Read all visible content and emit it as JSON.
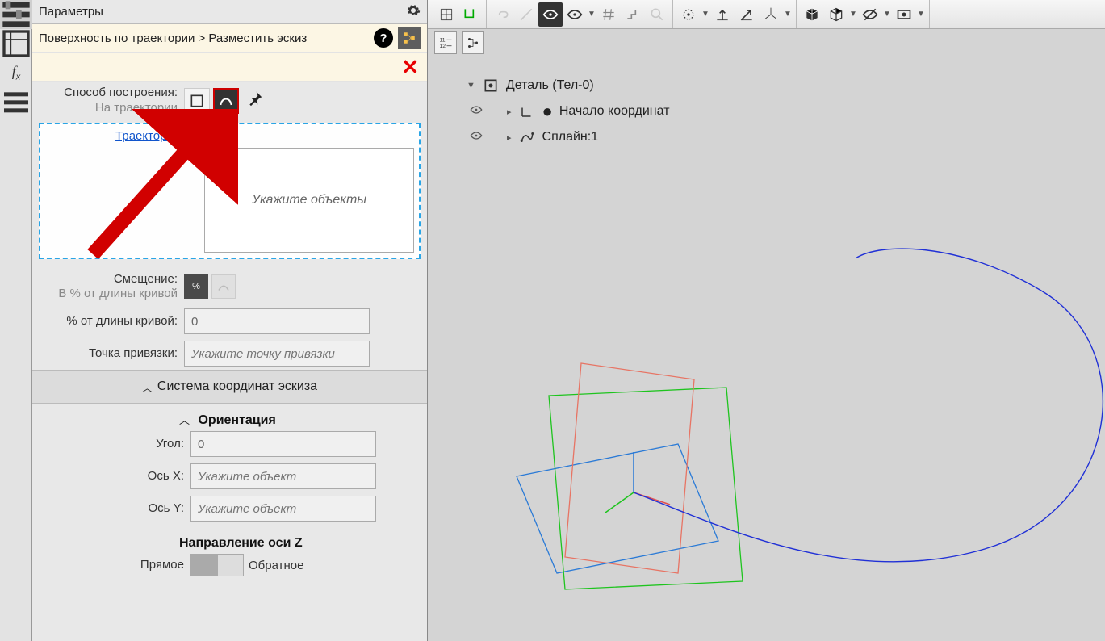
{
  "panel": {
    "title": "Параметры",
    "breadcrumb": "Поверхность по траектории > Разместить эскиз"
  },
  "build": {
    "method_label": "Способ построения:",
    "method_sub": "На траектории",
    "trajectory_link": "Траектория",
    "placeholder_objects": "Укажите объекты"
  },
  "offset": {
    "label1": "Смещение:",
    "label2": "В % от длины кривой",
    "pct_label": "% от длины кривой:",
    "pct_value": "0",
    "anchor_label": "Точка привязки:",
    "anchor_placeholder": "Укажите точку привязки"
  },
  "sections": {
    "coords": "Система координат эскиза",
    "orient": "Ориентация",
    "angle_label": "Угол:",
    "angle_value": "0",
    "axis_x_label": "Ось X:",
    "axis_y_label": "Ось Y:",
    "axis_placeholder": "Укажите объект",
    "z_dir": "Направление оси Z",
    "z_fwd": "Прямое",
    "z_rev": "Обратное"
  },
  "tree": {
    "root": "Деталь (Тел-0)",
    "n1": "Начало координат",
    "n2": "Сплайн:1"
  }
}
